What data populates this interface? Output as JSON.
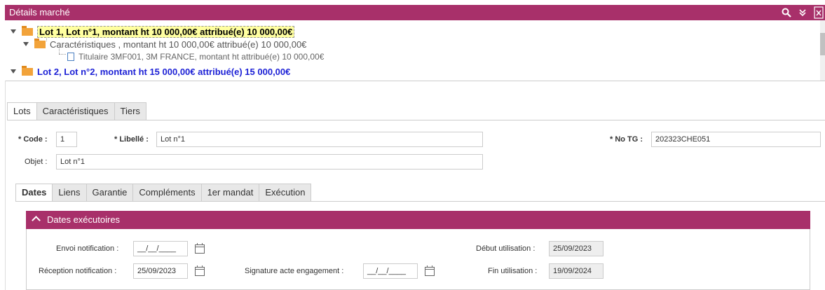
{
  "header": {
    "title": "Détails marché",
    "icons": [
      "search-icon",
      "double-chevron-down-icon",
      "excel-export-icon"
    ]
  },
  "tree": {
    "lot1": "Lot 1, Lot n°1,  montant ht 10 000,00€ attribué(e) 10 000,00€",
    "caracteristiques": "Caractéristiques , montant ht 10 000,00€ attribué(e) 10 000,00€",
    "titulaire": "Titulaire 3MF001, 3M FRANCE, montant ht attribué(e) 10 000,00€",
    "lot2": "Lot 2, Lot n°2,  montant ht 15 000,00€ attribué(e) 15 000,00€"
  },
  "tabs_main": [
    "Lots",
    "Caractéristiques",
    "Tiers"
  ],
  "form": {
    "code_label": "* Code :",
    "code_value": "1",
    "libelle_label": "* Libellé :",
    "libelle_value": "Lot n°1",
    "notg_label": "* No TG :",
    "notg_value": "202323CHE051",
    "objet_label": "Objet :",
    "objet_value": "Lot n°1"
  },
  "tabs_sub": [
    "Dates",
    "Liens",
    "Garantie",
    "Compléments",
    "1er mandat",
    "Exécution"
  ],
  "dates": {
    "section_title": "Dates exécutoires",
    "envoi_label": "Envoi notification :",
    "envoi_value": "__/__/____",
    "reception_label": "Réception notification :",
    "reception_value": "25/09/2023",
    "signature_label": "Signature acte engagement :",
    "signature_value": "__/__/____",
    "debut_label": "Début utilisation :",
    "debut_value": "25/09/2023",
    "fin_label": "Fin utilisation :",
    "fin_value": "19/09/2024"
  },
  "colors": {
    "accent": "#a8306a",
    "lot_highlight": "#ffffa0",
    "lot_link": "#1e22d6"
  }
}
